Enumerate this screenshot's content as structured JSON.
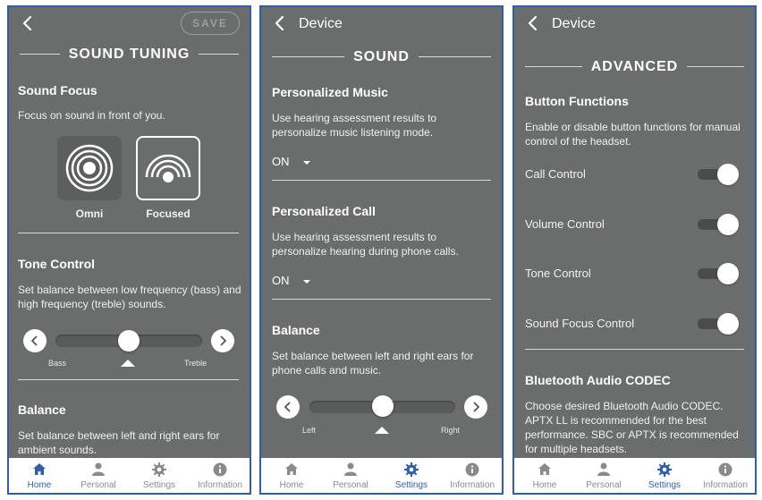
{
  "colors": {
    "panel_bg": "#6b6d6c",
    "frame": "#2f5eaa",
    "accent": "#2f5eaa",
    "tab_inactive": "#8a8a8a"
  },
  "tabs": [
    {
      "label": "Home",
      "icon": "home-icon"
    },
    {
      "label": "Personal",
      "icon": "person-icon"
    },
    {
      "label": "Settings",
      "icon": "gear-icon"
    },
    {
      "label": "Information",
      "icon": "info-icon"
    }
  ],
  "screen1": {
    "save_label": "SAVE",
    "section_title": "SOUND TUNING",
    "sound_focus": {
      "title": "Sound Focus",
      "description": "Focus on sound in front of you.",
      "omni_label": "Omni",
      "focused_label": "Focused",
      "selected": "Focused"
    },
    "tone_control": {
      "title": "Tone Control",
      "description": "Set balance between low frequency (bass) and high frequency (treble) sounds.",
      "left_label": "Bass",
      "right_label": "Treble",
      "value": 0.5
    },
    "balance": {
      "title": "Balance",
      "description": "Set balance between left and right ears for ambient sounds."
    },
    "active_tab": "Home"
  },
  "screen2": {
    "header_title": "Device",
    "section_title": "SOUND",
    "personalized_music": {
      "title": "Personalized Music",
      "description": "Use hearing assessment results to personalize music listening mode.",
      "value": "ON"
    },
    "personalized_call": {
      "title": "Personalized Call",
      "description": "Use hearing assessment results to personalize hearing during phone calls.",
      "value": "ON"
    },
    "balance": {
      "title": "Balance",
      "description": "Set balance between left and right ears for phone calls and music.",
      "left_label": "Left",
      "right_label": "Right",
      "value": 0.5
    },
    "active_tab": "Settings"
  },
  "screen3": {
    "header_title": "Device",
    "section_title": "ADVANCED",
    "button_functions": {
      "title": "Button Functions",
      "description": "Enable or disable button functions for manual control of the headset.",
      "items": [
        {
          "label": "Call Control",
          "on": true
        },
        {
          "label": "Volume Control",
          "on": true
        },
        {
          "label": "Tone Control",
          "on": true
        },
        {
          "label": "Sound Focus Control",
          "on": true
        }
      ]
    },
    "codec": {
      "title": "Bluetooth Audio CODEC",
      "description": "Choose desired Bluetooth Audio CODEC. APTX LL is recommended for the best performance. SBC or APTX is recommended for multiple headsets."
    },
    "active_tab": "Settings"
  }
}
